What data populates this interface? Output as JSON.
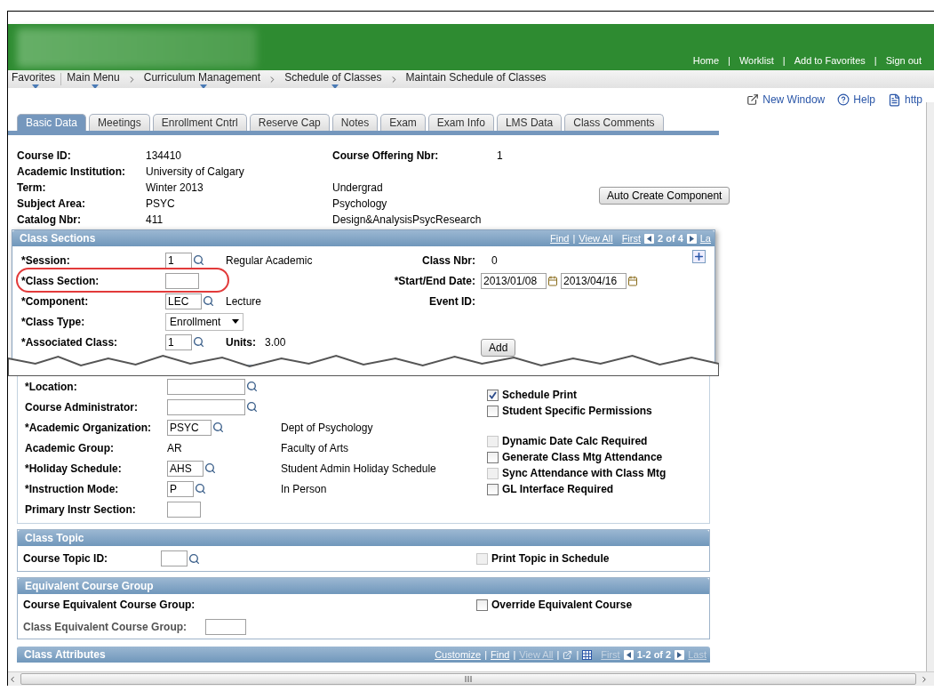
{
  "header": {
    "links": [
      "Home",
      "Worklist",
      "Add to Favorites",
      "Sign out"
    ],
    "separator": "|"
  },
  "breadcrumbs": [
    {
      "label": "Favorites",
      "menu": true
    },
    {
      "label": "Main Menu",
      "menu": true
    },
    {
      "label": "Curriculum Management",
      "menu": true
    },
    {
      "label": "Schedule of Classes",
      "menu": true
    },
    {
      "label": "Maintain Schedule of Classes",
      "menu": false
    }
  ],
  "toolbar": [
    {
      "kind": "new-window",
      "label": "New Window"
    },
    {
      "kind": "help",
      "label": "Help"
    },
    {
      "kind": "http",
      "label": "http"
    }
  ],
  "tabs": [
    {
      "label": "Basic Data",
      "selected": true
    },
    {
      "label": "Meetings",
      "selected": false
    },
    {
      "label": "Enrollment Cntrl",
      "selected": false
    },
    {
      "label": "Reserve Cap",
      "selected": false
    },
    {
      "label": "Notes",
      "selected": false
    },
    {
      "label": "Exam",
      "selected": false
    },
    {
      "label": "Exam Info",
      "selected": false
    },
    {
      "label": "LMS Data",
      "selected": false
    },
    {
      "label": "Class Comments",
      "selected": false
    }
  ],
  "course_info": {
    "rows": [
      {
        "label": "Course ID:",
        "value": "134410",
        "extra_label": "Course Offering Nbr:",
        "extra_value": "1"
      },
      {
        "label": "Academic Institution:",
        "value": "University of Calgary"
      },
      {
        "label": "Term:",
        "value": "Winter 2013",
        "description": "Undergrad"
      },
      {
        "label": "Subject Area:",
        "value": "PSYC",
        "description": "Psychology"
      },
      {
        "label": "Catalog Nbr:",
        "value": "411",
        "description": "Design&AnalysisPsycResearch"
      }
    ],
    "button": "Auto Create Component"
  },
  "class_sections": {
    "title": "Class Sections",
    "nav": {
      "find": "Find",
      "separator": "|",
      "view_all": "View All",
      "first": "First",
      "count": "2 of 4",
      "last": "La"
    },
    "rows": [
      {
        "label": "*Session:",
        "field": {
          "kind": "lookup",
          "value": "1"
        },
        "description": "Regular Academic",
        "right_label": "Class Nbr:",
        "right_value": "0"
      },
      {
        "label": "*Class Section:",
        "field": {
          "kind": "input"
        },
        "highlighted": true,
        "right_label": "*Start/End Date:",
        "dates": [
          "2013/01/08",
          "2013/04/16"
        ]
      },
      {
        "label": "*Component:",
        "field": {
          "kind": "lookup",
          "value": "LEC"
        },
        "description": "Lecture",
        "right_label": "Event ID:"
      },
      {
        "label": "*Class Type:",
        "field": {
          "kind": "select",
          "value": "Enrollment"
        }
      },
      {
        "label": "*Associated Class:",
        "field": {
          "kind": "lookup",
          "value": "1"
        },
        "units_label": "Units:",
        "units_value": "3.00",
        "button": "Add"
      }
    ]
  },
  "details": {
    "fields": [
      {
        "label": "*Location:",
        "field": {
          "kind": "lookup"
        }
      },
      {
        "label": "Course Administrator:",
        "field": {
          "kind": "lookup"
        }
      },
      {
        "label": "*Academic Organization:",
        "field": {
          "kind": "lookup",
          "value": "PSYC"
        },
        "description": "Dept of Psychology"
      },
      {
        "label": "Academic Group:",
        "value": "AR",
        "description": "Faculty of Arts"
      },
      {
        "label": "*Holiday Schedule:",
        "field": {
          "kind": "lookup",
          "value": "AHS"
        },
        "description": "Student Admin Holiday Schedule"
      },
      {
        "label": "*Instruction Mode:",
        "field": {
          "kind": "lookup",
          "value": "P"
        },
        "description": "In Person"
      },
      {
        "label": "Primary Instr Section:",
        "field": {
          "kind": "input"
        }
      }
    ],
    "checkbox_groups": [
      [
        {
          "label": "Schedule Print",
          "checked": true,
          "disabled": false
        },
        {
          "label": "Student Specific Permissions",
          "checked": false,
          "disabled": false
        }
      ],
      [
        {
          "label": "Dynamic Date Calc Required",
          "checked": false,
          "disabled": true
        },
        {
          "label": "Generate Class Mtg Attendance",
          "checked": false,
          "disabled": false
        },
        {
          "label": "Sync Attendance with Class Mtg",
          "checked": false,
          "disabled": true
        },
        {
          "label": "GL Interface Required",
          "checked": false,
          "disabled": false
        }
      ]
    ]
  },
  "class_topic": {
    "title": "Class Topic",
    "label": "Course Topic ID:",
    "checkbox": {
      "label": "Print Topic in Schedule",
      "checked": false,
      "disabled": true
    }
  },
  "equivalent_course_group": {
    "title": "Equivalent Course Group",
    "label": "Course Equivalent Course Group:",
    "checkbox": {
      "label": "Override Equivalent Course",
      "checked": false,
      "disabled": false
    },
    "class_label": "Class Equivalent Course Group:"
  },
  "class_attributes": {
    "title": "Class Attributes",
    "nav": {
      "customize": "Customize",
      "separator": "|",
      "find": "Find",
      "view_all": "View All",
      "first": "First",
      "count": "1-2 of 2",
      "last": "Last"
    }
  }
}
